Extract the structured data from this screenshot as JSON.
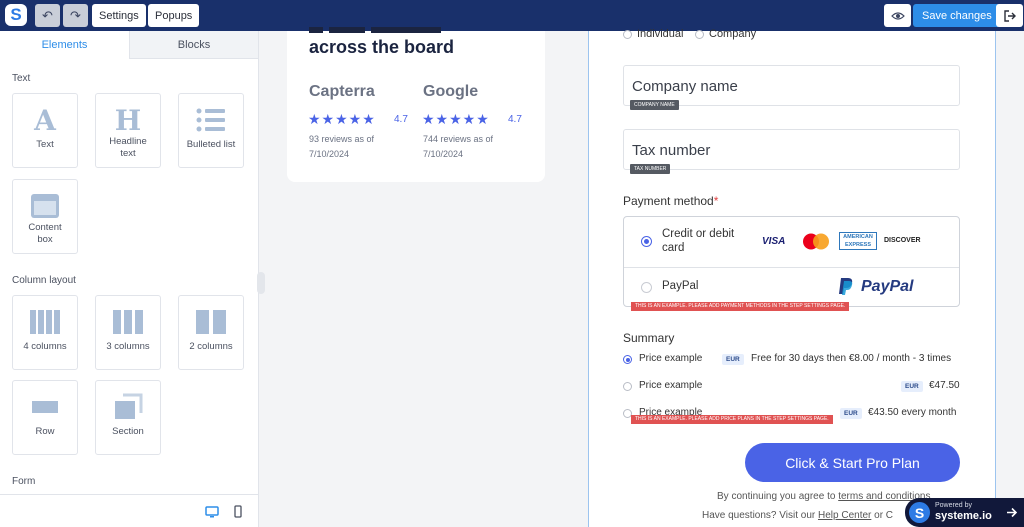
{
  "topbar": {
    "logo_letter": "S",
    "undo_icon": "↶",
    "redo_icon": "↷",
    "settings_label": "Settings",
    "popups_label": "Popups",
    "save_label": "Save changes"
  },
  "sidebar": {
    "tabs": [
      "Elements",
      "Blocks"
    ],
    "sections": {
      "text": "Text",
      "column_layout": "Column layout",
      "form": "Form"
    },
    "text_items": [
      "Text",
      "Headline text",
      "Bulleted list",
      "Content box"
    ],
    "column_items": [
      "4 columns",
      "3 columns",
      "2 columns",
      "Row",
      "Section"
    ],
    "content_box_lines": [
      "Content",
      "box"
    ],
    "headline_lines": [
      "Headline",
      "text"
    ]
  },
  "reviews": {
    "heading": "across the board",
    "platforms": [
      {
        "name": "Capterra",
        "stars": "★★★★★",
        "rating": "4.7",
        "line1": "93 reviews as of",
        "line2": "7/10/2024"
      },
      {
        "name": "Google",
        "stars": "★★★★★",
        "rating": "4.7",
        "line1": "744 reviews as of",
        "line2": "7/10/2024"
      }
    ]
  },
  "form": {
    "type_options": [
      "Individual",
      "Company"
    ],
    "company_name_placeholder": "Company name",
    "company_name_tag": "COMPANY NAME",
    "tax_number_placeholder": "Tax number",
    "tax_number_tag": "TAX NUMBER",
    "payment_title": "Payment method",
    "payment_required": "*",
    "payment_options": [
      {
        "label_line1": "Credit or debit",
        "label_line2": "card",
        "selected": true
      },
      {
        "label_line1": "PayPal",
        "selected": false
      }
    ],
    "card_brands": {
      "visa": "VISA",
      "amex_line1": "AMERICAN",
      "amex_line2": "EXPRESS",
      "discover": "DISCOVER"
    },
    "paypal_brand": "PayPal",
    "payment_warning": "THIS IS AN EXAMPLE. PLEASE ADD PAYMENT METHODS IN THE STEP SETTINGS PAGE.",
    "summary_title": "Summary",
    "plans": [
      {
        "name": "Price example",
        "currency": "EUR",
        "price": "Free for 30 days then €8.00 / month - 3 times",
        "selected": true
      },
      {
        "name": "Price example",
        "currency": "EUR",
        "price": "€47.50",
        "selected": false
      },
      {
        "name": "Price example",
        "currency": "EUR",
        "price": "€43.50 every month",
        "selected": false
      }
    ],
    "plans_warning": "THIS IS AN EXAMPLE. PLEASE ADD PRICE PLANS IN THE STEP SETTINGS PAGE.",
    "cta_label": "Click & Start Pro Plan",
    "terms_prefix": "By continuing you agree to ",
    "terms_link": "terms and conditions",
    "help_prefix": "Have questions? Visit our ",
    "help_link": "Help Center",
    "help_suffix": " or C"
  },
  "powered_by": {
    "line1": "Powered by",
    "line2": "systeme.io",
    "logo_letter": "S"
  },
  "colors": {
    "brand": "#19306b",
    "accent": "#2d8de8",
    "cta": "#4a63e6",
    "warning": "#e05252"
  }
}
